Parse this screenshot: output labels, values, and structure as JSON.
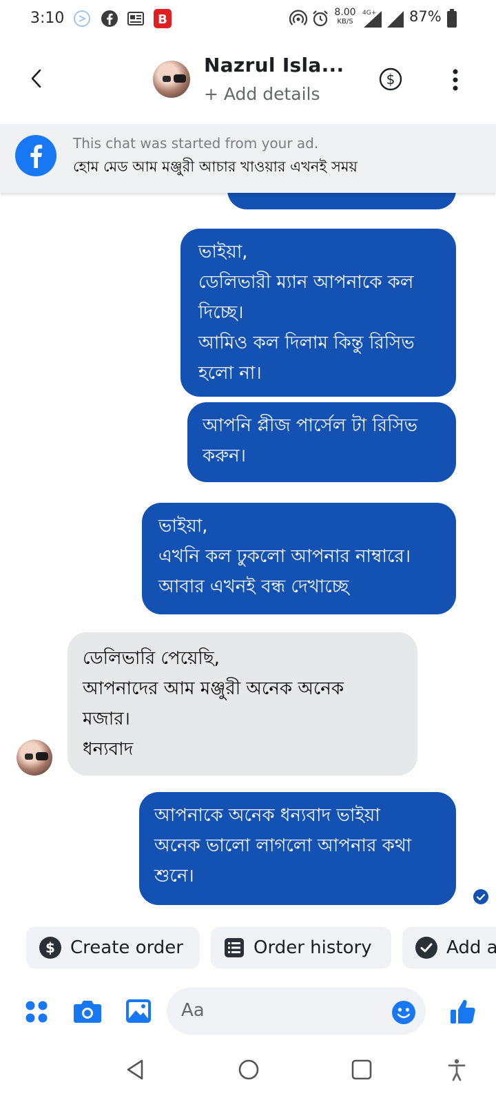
{
  "status_bar": {
    "time": "3:10",
    "speed_value": "8.00",
    "speed_unit": "KB/S",
    "network": "4G+",
    "battery": "87%"
  },
  "header": {
    "name": "Nazrul Isla...",
    "subtitle": "+ Add details"
  },
  "ad_banner": {
    "line1": "This chat was started from your ad.",
    "line2": "হোম মেড আম মঞ্জুরী আচার খাওয়ার এখনই সময়"
  },
  "messages": [
    {
      "direction": "outgoing",
      "lines": [
        "ভাইয়া,",
        "ডেলিভারী ম্যান আপনাকে কল",
        "দিচ্ছে।",
        "আমিও কল দিলাম কিন্তু রিসিভ",
        "হলো না।"
      ]
    },
    {
      "direction": "outgoing",
      "lines": [
        "আপনি প্লীজ পার্সেল টা রিসিভ",
        "করুন।"
      ]
    },
    {
      "direction": "outgoing",
      "lines": [
        "ভাইয়া,",
        "এখনি কল ঢুকলো আপনার নাম্বারে।",
        "আবার এখনই বন্ধ দেখাচ্ছে"
      ]
    },
    {
      "direction": "incoming",
      "lines": [
        "ডেলিভারি পেয়েছি,",
        "আপনাদের আম মঞ্জুরী অনেক অনেক",
        "মজার।",
        "ধন্যবাদ"
      ]
    },
    {
      "direction": "outgoing",
      "lines": [
        "আপনাকে অনেক ধন্যবাদ ভাইয়া",
        "অনেক ভালো লাগলো আপনার কথা",
        "শুনে।"
      ]
    }
  ],
  "quick_actions": [
    {
      "label": "Create order",
      "icon": "dollar-icon"
    },
    {
      "label": "Order history",
      "icon": "list-icon"
    },
    {
      "label": "Add a",
      "icon": "check-icon"
    }
  ],
  "composer": {
    "placeholder": "Aa"
  },
  "colors": {
    "outgoing_bubble": "#1352b2",
    "incoming_bubble": "#e7e8ea",
    "accent": "#1877f2"
  }
}
